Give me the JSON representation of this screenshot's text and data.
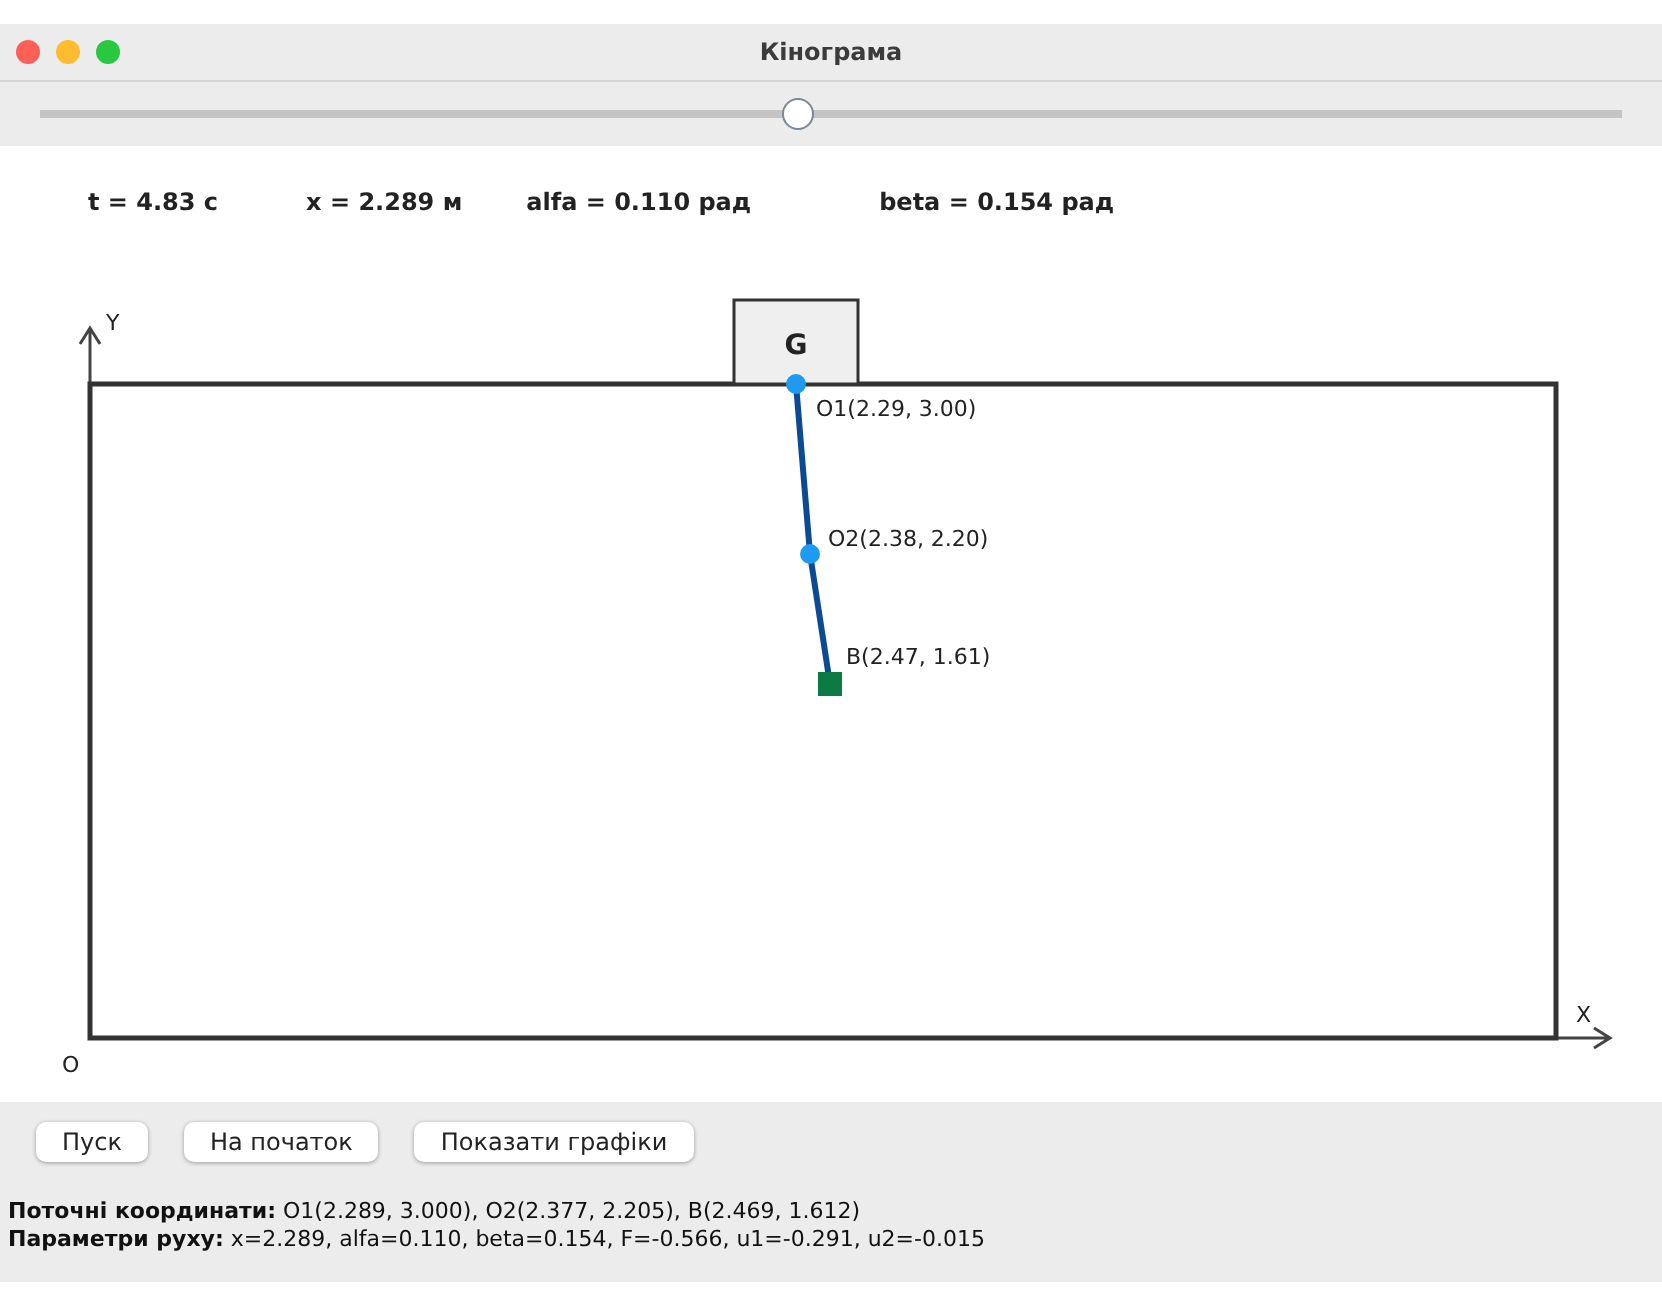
{
  "window": {
    "title": "Кінограма"
  },
  "slider": {
    "level": 0.48
  },
  "readouts": [
    "t = 4.83 с",
    "x = 2.289 м",
    "alfa = 0.110 рад",
    "beta = 0.154 рад"
  ],
  "canvas": {
    "y_axis": "Y",
    "x_axis": "X",
    "origin": "O",
    "block": "G",
    "points": [
      {
        "kind": "joint",
        "label": "O1(2.29, 3.00)"
      },
      {
        "kind": "joint",
        "label": "O2(2.38, 2.20)"
      },
      {
        "kind": "end",
        "label": "B(2.47, 1.61)"
      }
    ]
  },
  "buttons": [
    "Пуск",
    "На початок",
    "Показати графіки"
  ],
  "status": [
    "**Поточні координати:** O1(2.289, 3.000), O2(2.377, 2.205), B(2.469, 1.612)",
    "**Параметри руху:** x=2.289, alfa=0.110, beta=0.154, F=-0.566, u1=-0.291, u2=-0.015"
  ]
}
